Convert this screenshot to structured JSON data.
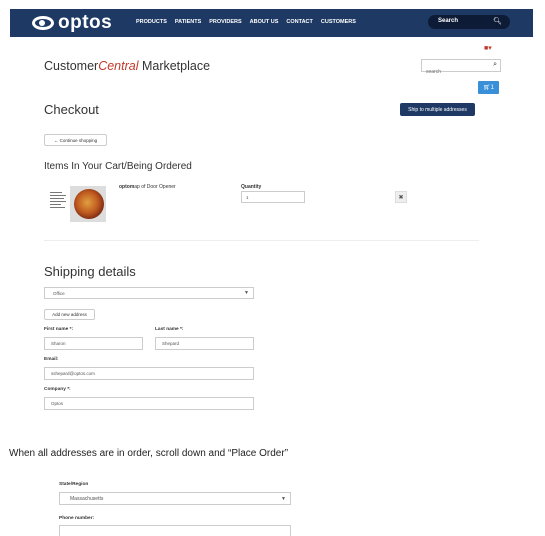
{
  "nav": {
    "logo": "optos",
    "items": [
      "PRODUCTS",
      "PATIENTS",
      "PROVIDERS",
      "ABOUT US",
      "CONTACT",
      "CUSTOMERS"
    ],
    "search_label": "Search"
  },
  "header": {
    "brand_prefix": "Customer",
    "brand_accent": "Central",
    "brand_suffix": " Marketplace",
    "search_placeholder": "search",
    "cart_count": "1"
  },
  "checkout": {
    "title": "Checkout",
    "ship_multi_label": "Ship to multiple addresses",
    "continue_label": "Continue shopping"
  },
  "cart": {
    "title": "Items In Your Cart/Being Ordered",
    "product_brand": "optom",
    "product_name": "ap of Door Opener",
    "quantity_label": "Quantity",
    "quantity_value": "1",
    "remove_symbol": "✖"
  },
  "shipping": {
    "title": "Shipping details",
    "address_selected": "Office",
    "add_address_label": "Add new address",
    "first_name_label": "First name *:",
    "first_name_value": "Sharon",
    "last_name_label": "Last name *:",
    "last_name_value": "Shepard",
    "email_label": "Email:",
    "email_value": "sshepard@optos.com",
    "company_label": "Company *:",
    "company_value": "Optos"
  },
  "instruction": "When all addresses are in order, scroll down and “Place Order”",
  "lower_form": {
    "state_label": "State/Region",
    "state_value": "Massachusetts",
    "phone_label": "Phone number:"
  },
  "colors": {
    "nav_bg": "#1e3a64",
    "accent_red": "#c0392b",
    "cart_blue": "#3a8fd9"
  }
}
